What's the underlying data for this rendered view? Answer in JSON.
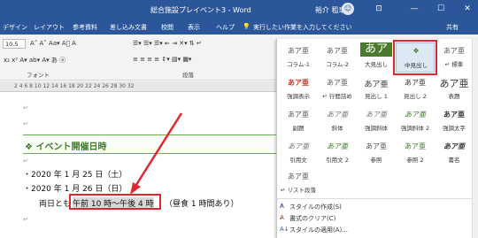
{
  "window": {
    "title": "総合施設プレイベント3 - Word",
    "user": "裕介 租車",
    "avatar_glyph": "☺",
    "ribbon_display_icon": "⊡",
    "minimize_icon": "—",
    "maximize_icon": "☐",
    "close_icon": "✕"
  },
  "tabs": [
    "デザイン",
    "レイアウト",
    "参考資料",
    "差し込み文書",
    "校閲",
    "表示",
    "ヘルプ",
    "実行したい作業を入力してください",
    "共有"
  ],
  "ribbon": {
    "font_size": "10.5",
    "font_group_label": "フォント",
    "paragraph_group_label": "段落",
    "font_row1": "A˄ A˅  Aa▾  A⃝  A",
    "font_row2": "x₂  x²  A▾  ab▾  A▾  あ  ⓐ",
    "para_row1": "☰▾ ☰▾ ☰▾   ⇤ ⇥   ✕▾  ⇅  ↵",
    "para_row2": "≡  ≡  ≡  ≡   ⇕▾  ▧▾  ▦▾"
  },
  "ruler_text": "2  4  6  8  10  12  14  16  18  20  22  24  26  28  30  32",
  "document": {
    "heading": "❖ イベント開催日時",
    "date1": "・2020 年 1 月 25 日（土）",
    "date2": "・2020 年 1 月 26 日（日）",
    "time_prefix": "両日とも",
    "time_highlight": "午前 10 時～午後 4 時",
    "time_suffix": "（昼食 1 時間あり）",
    "para_mark": "↵"
  },
  "styles_gallery": {
    "rows": [
      [
        {
          "preview": "あア亜",
          "name": "コラム-1"
        },
        {
          "preview": "あア亜",
          "name": "コラム-2"
        },
        {
          "preview": "あア",
          "name": "大見出し"
        },
        {
          "preview": "❖",
          "name": "中見出し"
        },
        {
          "preview": "あア亜",
          "name": "↵ 標準"
        }
      ],
      [
        {
          "preview": "あア亜",
          "name": "強調表示"
        },
        {
          "preview": "あア亜",
          "name": "↵ 行間詰め"
        },
        {
          "preview": "あア亜",
          "name": "見出し 1"
        },
        {
          "preview": "あア亜",
          "name": "見出し 2"
        },
        {
          "preview": "あア亜",
          "name": "表題"
        }
      ],
      [
        {
          "preview": "あア亜",
          "name": "副題"
        },
        {
          "preview": "あア亜",
          "name": "斜体"
        },
        {
          "preview": "あア亜",
          "name": "強調斜体"
        },
        {
          "preview": "あア亜",
          "name": "強調斜体 2"
        },
        {
          "preview": "あア亜",
          "name": "強調太字"
        }
      ],
      [
        {
          "preview": "あア亜",
          "name": "引用文"
        },
        {
          "preview": "あア亜",
          "name": "引用文 2"
        },
        {
          "preview": "あア亜",
          "name": "参照"
        },
        {
          "preview": "あア亜",
          "name": "参照 2"
        },
        {
          "preview": "あア亜",
          "name": "書名"
        }
      ],
      [
        {
          "preview": "あア亜",
          "name": "↵ リスト段落"
        }
      ]
    ],
    "menu": [
      "スタイルの作成(S)",
      "書式のクリア(C)",
      "スタイルの適用(A)..."
    ]
  },
  "colors": {
    "titlebar": "#2b579a",
    "heading_green": "#3f7a2a",
    "highlight_red": "#e3262d",
    "selected_style_bg": "#dde8f5"
  }
}
